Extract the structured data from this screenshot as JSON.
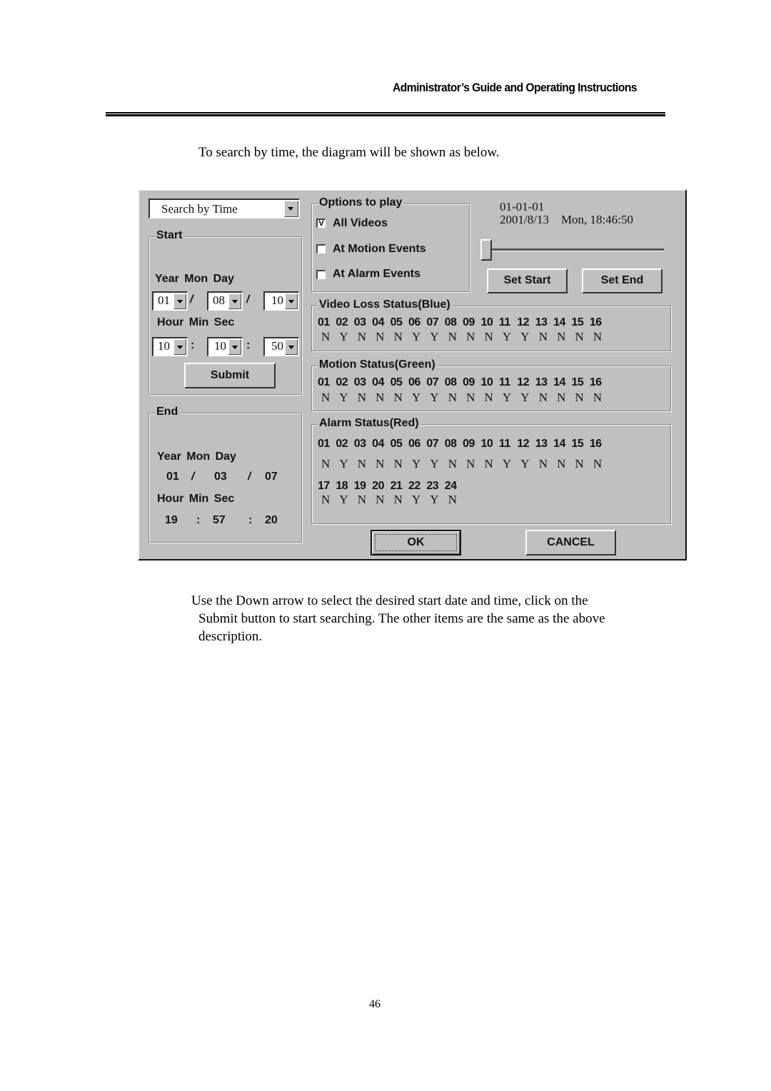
{
  "page": {
    "header_title": "Administrator’s Guide and Operating Instructions",
    "intro": "To search by time, the diagram will be shown as below.",
    "paragraph_lines": [
      "Use the Down arrow to select the desired start date and time, click on the",
      "Submit button to start searching. The other items are the same as the above",
      "description."
    ],
    "page_number": "46"
  },
  "dialog": {
    "search_mode": {
      "selected": "Search by Time"
    },
    "start": {
      "title": "Start",
      "date_label": "Year  Mon  Day",
      "time_label": "Hour  Min  Sec",
      "year": "01",
      "month": "08",
      "day": "10",
      "hour": "10",
      "minute": "10",
      "second": "50",
      "date_sep": "/",
      "time_sep": ":",
      "submit_label": "Submit"
    },
    "end": {
      "title": "End",
      "date_label": "Year  Mon  Day",
      "time_label": "Hour  Min  Sec",
      "year": "01",
      "month": "03",
      "day": "07",
      "hour": "19",
      "minute": "57",
      "second": "20",
      "date_sep": "/",
      "time_sep": ":"
    },
    "options": {
      "title": "Options to play",
      "items": [
        {
          "label": "All Videos",
          "checked": true,
          "mark": "V"
        },
        {
          "label": "At Motion Events",
          "checked": false,
          "mark": ""
        },
        {
          "label": "At Alarm Events",
          "checked": false,
          "mark": ""
        }
      ]
    },
    "playback": {
      "clip_id": "01-01-01",
      "datetime": "2001/8/13    Mon, 18:46:50",
      "slider_position": 0,
      "set_start_label": "Set Start",
      "set_end_label": "Set End"
    },
    "video_loss": {
      "title": "Video Loss Status(Blue)",
      "channels": [
        "01",
        "02",
        "03",
        "04",
        "05",
        "06",
        "07",
        "08",
        "09",
        "10",
        "11",
        "12",
        "13",
        "14",
        "15",
        "16"
      ],
      "values": [
        "N",
        "Y",
        "N",
        "N",
        "N",
        "Y",
        "Y",
        "N",
        "N",
        "N",
        "Y",
        "Y",
        "N",
        "N",
        "N",
        "N"
      ]
    },
    "motion": {
      "title": "Motion Status(Green)",
      "channels": [
        "01",
        "02",
        "03",
        "04",
        "05",
        "06",
        "07",
        "08",
        "09",
        "10",
        "11",
        "12",
        "13",
        "14",
        "15",
        "16"
      ],
      "values": [
        "N",
        "Y",
        "N",
        "N",
        "N",
        "Y",
        "Y",
        "N",
        "N",
        "N",
        "Y",
        "Y",
        "N",
        "N",
        "N",
        "N"
      ]
    },
    "alarm": {
      "title": "Alarm Status(Red)",
      "channels": [
        "01",
        "02",
        "03",
        "04",
        "05",
        "06",
        "07",
        "08",
        "09",
        "10",
        "11",
        "12",
        "13",
        "14",
        "15",
        "16"
      ],
      "values": [
        "N",
        "Y",
        "N",
        "N",
        "N",
        "Y",
        "Y",
        "N",
        "N",
        "N",
        "Y",
        "Y",
        "N",
        "N",
        "N",
        "N"
      ],
      "channels_2": [
        "17",
        "18",
        "19",
        "20",
        "21",
        "22",
        "23",
        "24"
      ],
      "values_2": [
        "N",
        "Y",
        "N",
        "N",
        "N",
        "Y",
        "Y",
        "N"
      ]
    },
    "ok_label": "OK",
    "cancel_label": "CANCEL",
    "status_colors": {
      "video_loss": "#0000ff",
      "motion": "#00a000",
      "alarm": "#ff0000"
    }
  }
}
